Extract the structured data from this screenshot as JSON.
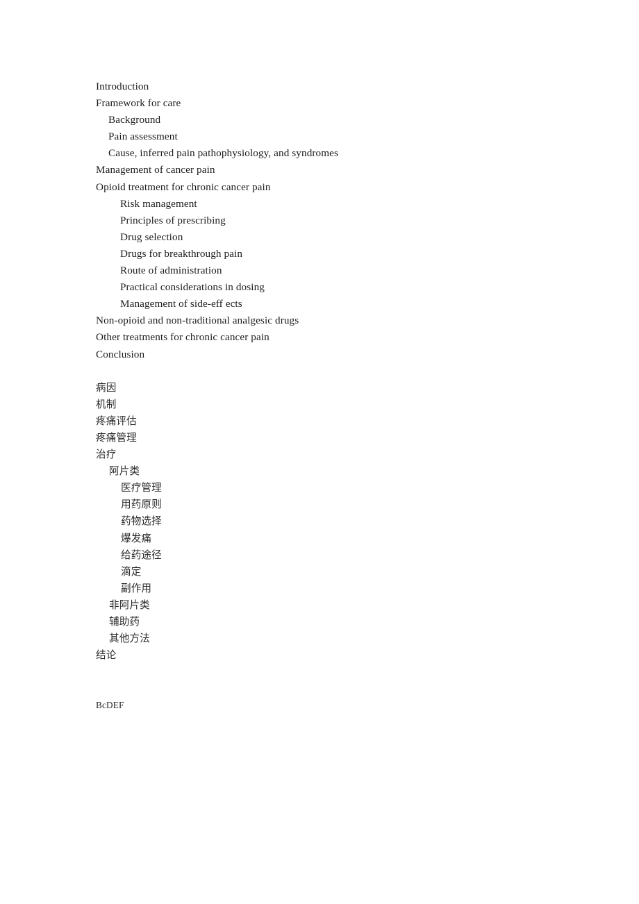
{
  "document": {
    "background_color": "#ffffff",
    "text_color": "#1c1c1c",
    "english_outline": [
      {
        "label": "Introduction",
        "level": 0
      },
      {
        "label": "Framework for care",
        "level": 0
      },
      {
        "label": "Background",
        "level": 1
      },
      {
        "label": "Pain assessment",
        "level": 1
      },
      {
        "label": "Cause, inferred pain pathophysiology, and syndromes",
        "level": 1
      },
      {
        "label": "Management of cancer pain",
        "level": 0
      },
      {
        "label": "Opioid treatment for chronic cancer pain",
        "level": 0
      },
      {
        "label": "Risk management",
        "level": 2
      },
      {
        "label": "Principles of prescribing",
        "level": 2
      },
      {
        "label": "Drug selection",
        "level": 2
      },
      {
        "label": "Drugs for breakthrough pain",
        "level": 2
      },
      {
        "label": "Route of administration",
        "level": 2
      },
      {
        "label": "Practical considerations in dosing",
        "level": 2
      },
      {
        "label": "Management of side-eff ects",
        "level": 2
      },
      {
        "label": "Non-opioid and non-traditional analgesic drugs",
        "level": 0
      },
      {
        "label": "Other treatments for chronic cancer pain",
        "level": 0
      },
      {
        "label": "Conclusion",
        "level": 0
      }
    ],
    "chinese_outline": [
      {
        "label": "病因",
        "level": 0
      },
      {
        "label": "机制",
        "level": 0
      },
      {
        "label": "疼痛评估",
        "level": 0
      },
      {
        "label": "疼痛管理",
        "level": 0
      },
      {
        "label": "治疗",
        "level": 0
      },
      {
        "label": "阿片类",
        "level": 1
      },
      {
        "label": "医疗管理",
        "level": 2
      },
      {
        "label": "用药原则",
        "level": 2
      },
      {
        "label": "药物选择",
        "level": 2
      },
      {
        "label": "爆发痛",
        "level": 2
      },
      {
        "label": "给药途径",
        "level": 2
      },
      {
        "label": "滴定",
        "level": 2
      },
      {
        "label": "副作用",
        "level": 2
      },
      {
        "label": "非阿片类",
        "level": 1
      },
      {
        "label": "辅助药",
        "level": 1
      },
      {
        "label": "其他方法",
        "level": 1
      },
      {
        "label": "结论",
        "level": 0
      }
    ],
    "footer_mark": "BcDEF"
  }
}
